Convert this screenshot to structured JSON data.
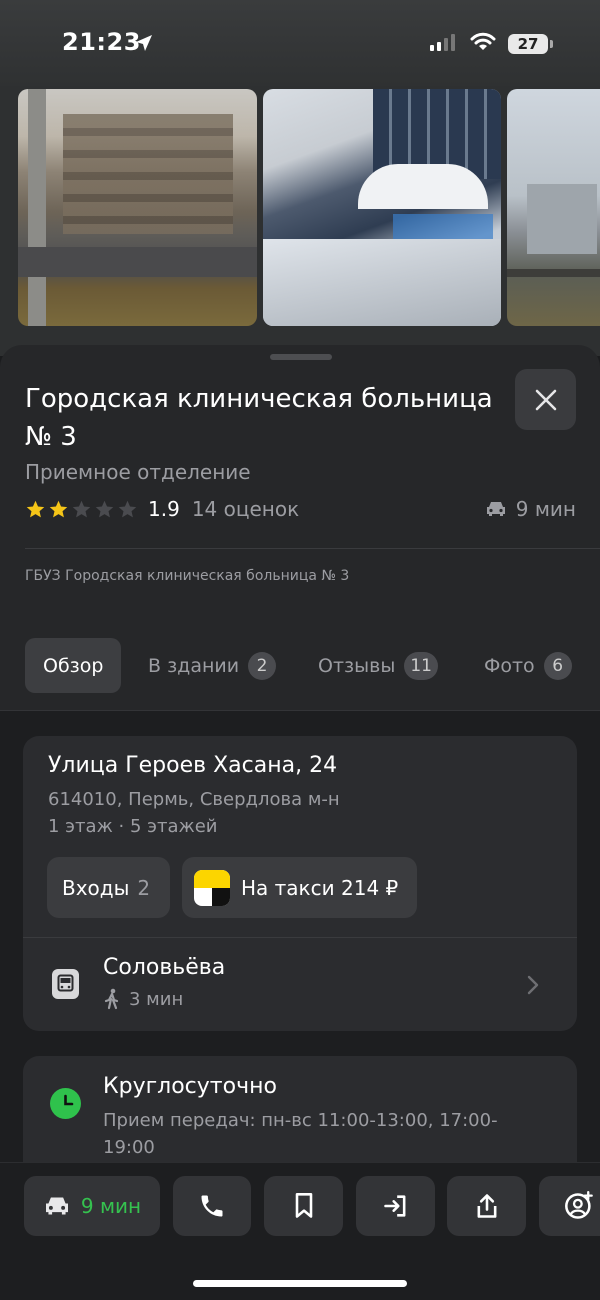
{
  "status_bar": {
    "time": "21:23",
    "battery": "27"
  },
  "place": {
    "title": "Городская клиническая больница № 3",
    "subtitle": "Приемное отделение",
    "rating": "1.9",
    "rating_stars_filled": 2,
    "rating_count": "14 оценок",
    "eta": "9 мин",
    "organization": "ГБУЗ Городская клиническая больница № 3"
  },
  "tabs": [
    {
      "label": "Обзор",
      "badge": ""
    },
    {
      "label": "В здании",
      "badge": "2"
    },
    {
      "label": "Отзывы",
      "badge": "11"
    },
    {
      "label": "Фото",
      "badge": "6"
    }
  ],
  "address": {
    "street": "Улица Героев Хасана, 24",
    "city": "614010, Пермь, Свердлова м-н",
    "floors": "1 этаж · 5 этажей",
    "entrances_label": "Входы",
    "entrances_count": "2",
    "taxi_label": "На такси 214 ₽"
  },
  "transit": {
    "stop": "Соловьёва",
    "walk": "3 мин"
  },
  "hours": {
    "title": "Круглосуточно",
    "details": "Прием передач: пн-вс 11:00-13:00, 17:00-19:00"
  },
  "actions": {
    "route_label": "9 мин"
  },
  "colors": {
    "accent_green": "#35c24f",
    "star_gold": "#f5c518",
    "open_green": "#2fc24c"
  }
}
